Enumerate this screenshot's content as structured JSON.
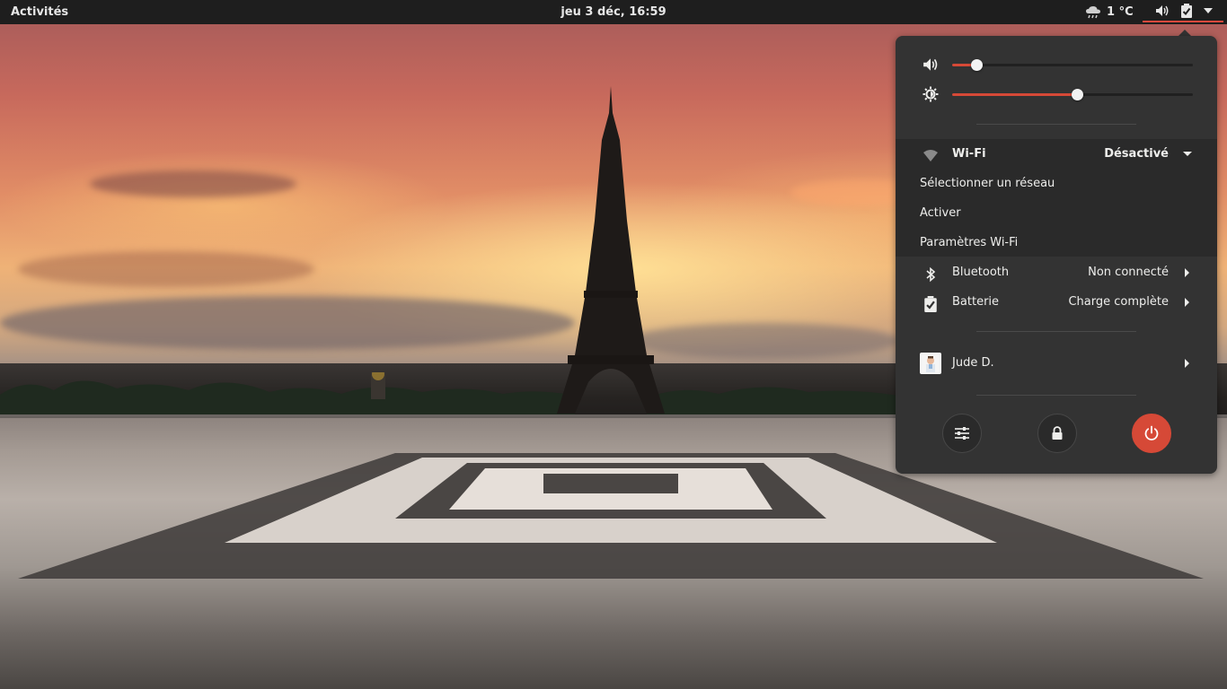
{
  "topbar": {
    "activities_label": "Activités",
    "clock": "jeu  3 déc, 16:59",
    "weather": {
      "icon": "weather-showers-icon",
      "temperature": "1 °C"
    },
    "indicators": [
      "audio-volume-icon",
      "battery-full-charged-icon",
      "system-menu-down-arrow-icon"
    ]
  },
  "system_menu": {
    "volume": {
      "icon": "audio-volume-icon",
      "level": 0.1
    },
    "brightness": {
      "icon": "display-brightness-icon",
      "level": 0.52
    },
    "wifi": {
      "icon": "wifi-off-icon",
      "label": "Wi-Fi",
      "status": "Désactivé",
      "submenu": [
        "Sélectionner un réseau",
        "Activer",
        "Paramètres Wi-Fi"
      ]
    },
    "bluetooth": {
      "icon": "bluetooth-icon",
      "label": "Bluetooth",
      "status": "Non connecté"
    },
    "battery": {
      "icon": "battery-full-charged-icon",
      "label": "Batterie",
      "status": "Charge complète"
    },
    "user": {
      "name": "Jude D."
    },
    "actions": [
      "settings-icon",
      "lock-icon",
      "power-icon"
    ],
    "accent": "#d64937"
  }
}
